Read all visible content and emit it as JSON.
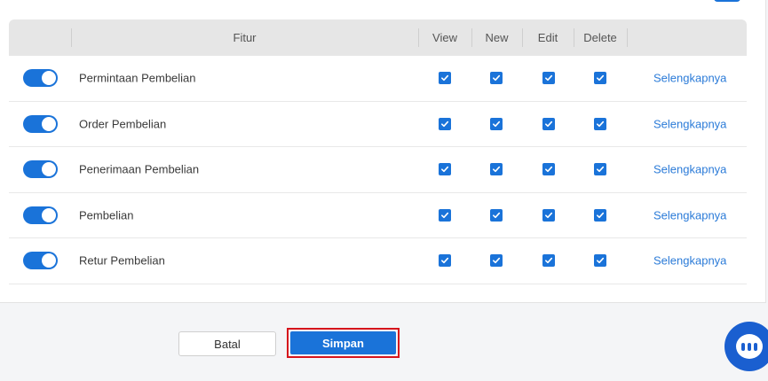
{
  "table": {
    "headers": {
      "feature": "Fitur",
      "view": "View",
      "new": "New",
      "edit": "Edit",
      "delete": "Delete"
    },
    "rows": [
      {
        "enabled": true,
        "name": "Permintaan Pembelian",
        "view": true,
        "new": true,
        "edit": true,
        "delete": true,
        "link": "Selengkapnya"
      },
      {
        "enabled": true,
        "name": "Order Pembelian",
        "view": true,
        "new": true,
        "edit": true,
        "delete": true,
        "link": "Selengkapnya"
      },
      {
        "enabled": true,
        "name": "Penerimaan Pembelian",
        "view": true,
        "new": true,
        "edit": true,
        "delete": true,
        "link": "Selengkapnya"
      },
      {
        "enabled": true,
        "name": "Pembelian",
        "view": true,
        "new": true,
        "edit": true,
        "delete": true,
        "link": "Selengkapnya"
      },
      {
        "enabled": true,
        "name": "Retur Pembelian",
        "view": true,
        "new": true,
        "edit": true,
        "delete": true,
        "link": "Selengkapnya"
      }
    ]
  },
  "footer": {
    "cancel_label": "Batal",
    "save_label": "Simpan"
  },
  "colors": {
    "accent": "#1a73d9",
    "link": "#2b7bd8",
    "highlight_outline": "#d6141c",
    "header_bg": "#e6e6e6"
  },
  "icons": {
    "chat": "chat-icon",
    "checkbox": "checkmark-icon"
  }
}
